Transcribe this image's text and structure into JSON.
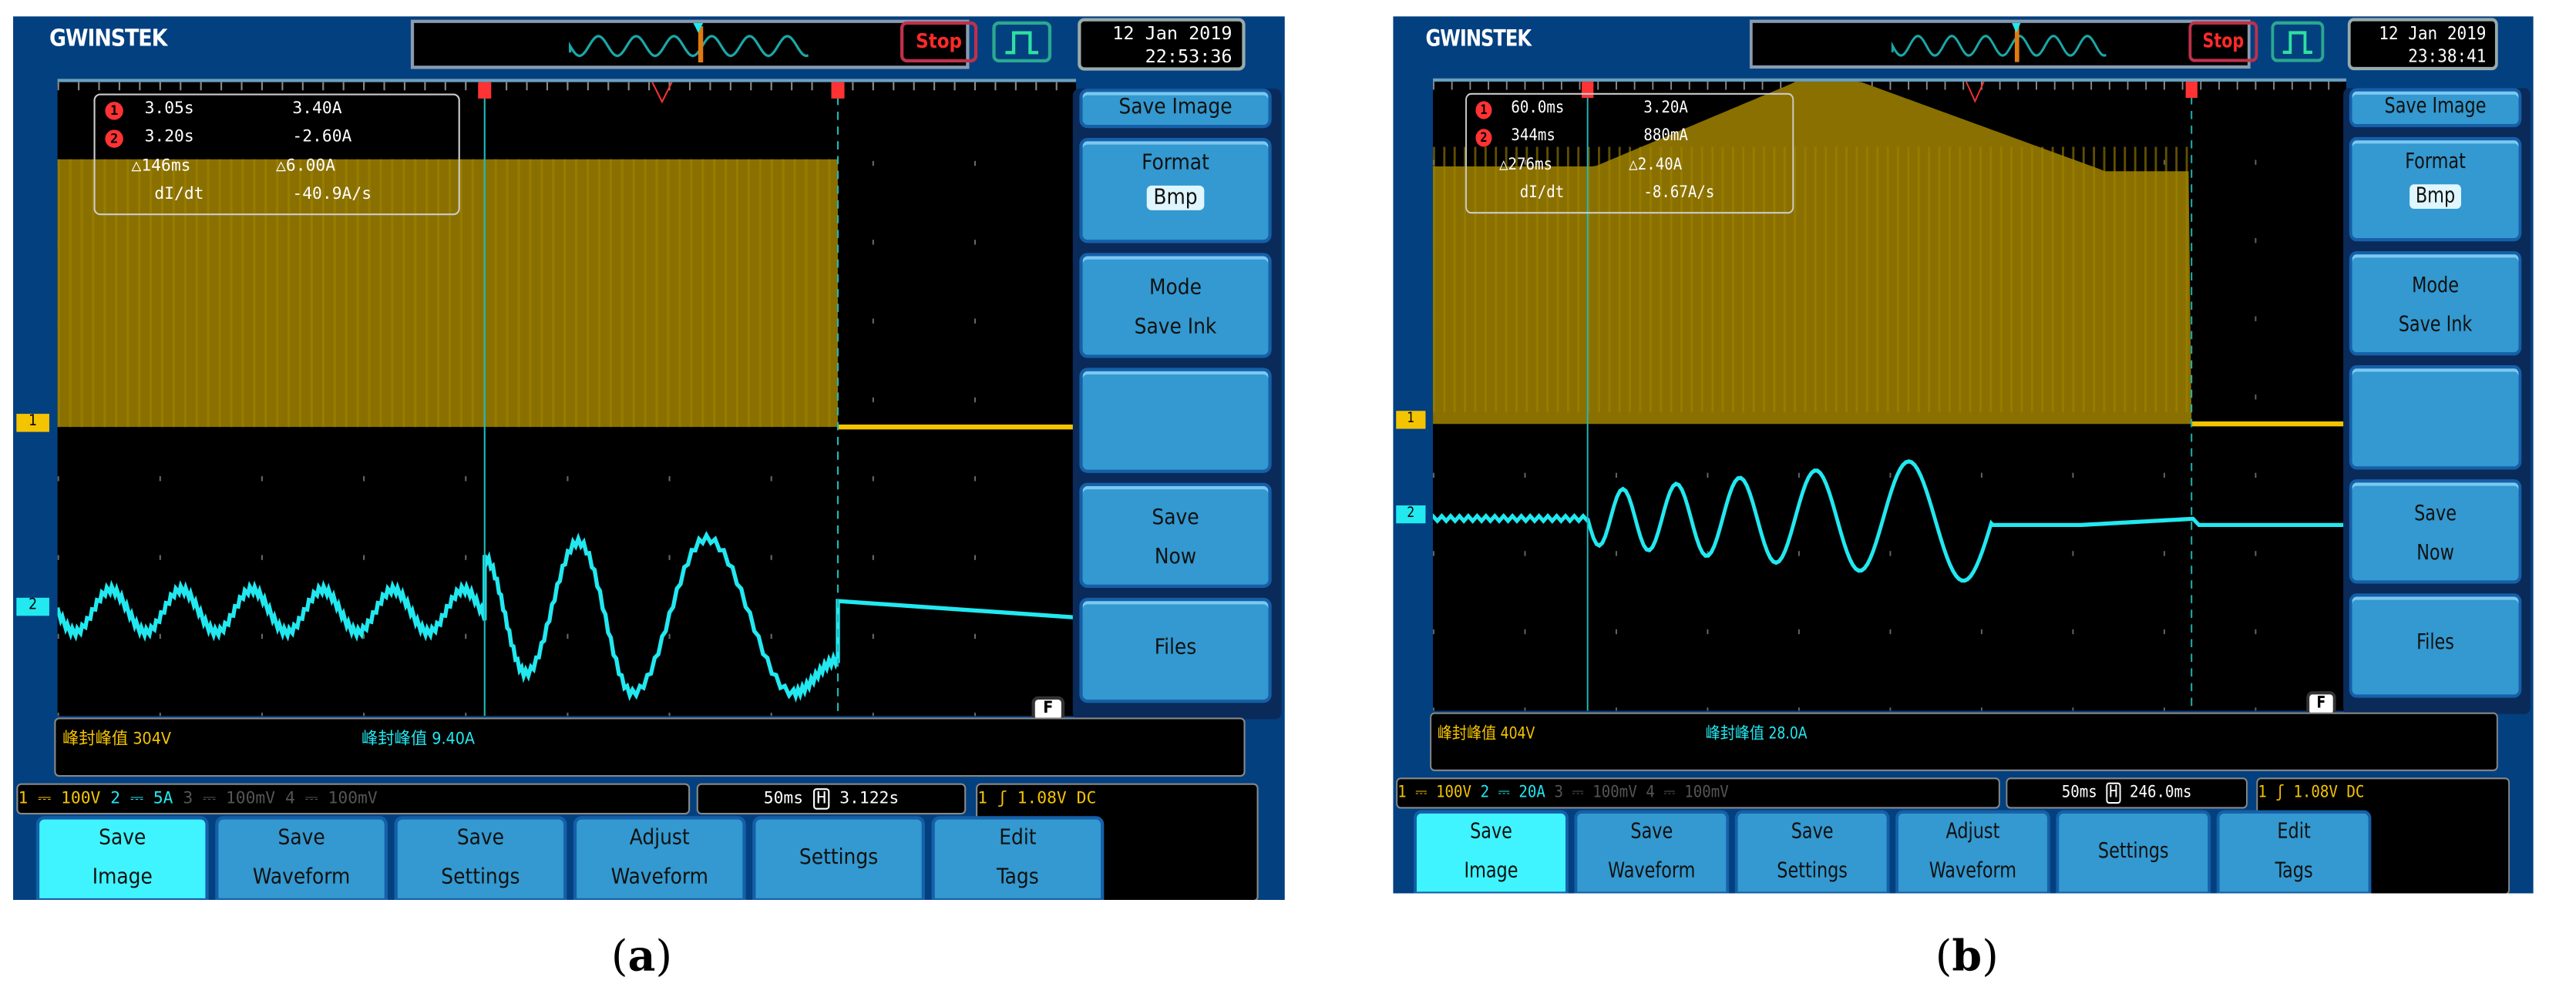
{
  "panels": [
    {
      "id": "a",
      "caption_open": "(",
      "caption_letter": "a",
      "caption_close": ")",
      "brand": "GWINSTEK",
      "run_state": "Stop",
      "date": "12 Jan 2019",
      "time": "22:53:36",
      "cursor1": {
        "time": "3.05s",
        "value": "3.40A"
      },
      "cursor2": {
        "time": "3.20s",
        "value": "-2.60A"
      },
      "delta_time": "△146ms",
      "delta_value": "△6.00A",
      "didt_label": "dI/dt",
      "didt_value": "-40.9A/s",
      "menu": {
        "title": "Save Image",
        "format_label": "Format",
        "format_value": "Bmp",
        "mode_label": "Mode",
        "mode_value": "Save Ink",
        "save_now_1": "Save",
        "save_now_2": "Now",
        "files": "Files",
        "f_key": "F"
      },
      "readout1": "峰封峰值 304V",
      "readout2": "峰封峰值 9.40A",
      "ch1_num": "1",
      "ch2_num": "2",
      "ch3_num": "3",
      "ch4_num": "4",
      "ch1_scale": "100V",
      "ch2_scale": "5A",
      "ch3_scale": "100mV",
      "ch4_scale": "100mV",
      "coupling": "⎓",
      "timebase": "50ms",
      "h_label": "H",
      "h_position": "3.122s",
      "trig_src": "1",
      "trig_slope": "ʃ",
      "trig_level": "1.08V",
      "trig_coupling": "DC",
      "buttons": [
        [
          "Save",
          "Image"
        ],
        [
          "Save",
          "Waveform"
        ],
        [
          "Save",
          "Settings"
        ],
        [
          "Adjust",
          "Waveform"
        ],
        [
          "Settings",
          ""
        ],
        [
          "Edit",
          "Tags"
        ]
      ]
    },
    {
      "id": "b",
      "caption_open": "(",
      "caption_letter": "b",
      "caption_close": ")",
      "brand": "GWINSTEK",
      "run_state": "Stop",
      "date": "12 Jan 2019",
      "time": "23:38:41",
      "cursor1": {
        "time": "60.0ms",
        "value": "3.20A"
      },
      "cursor2": {
        "time": "344ms",
        "value": "880mA"
      },
      "delta_time": "△276ms",
      "delta_value": "△2.40A",
      "didt_label": "dI/dt",
      "didt_value": "-8.67A/s",
      "menu": {
        "title": "Save Image",
        "format_label": "Format",
        "format_value": "Bmp",
        "mode_label": "Mode",
        "mode_value": "Save Ink",
        "save_now_1": "Save",
        "save_now_2": "Now",
        "files": "Files",
        "f_key": "F"
      },
      "readout1": "峰封峰值 404V",
      "readout2": "峰封峰值 28.0A",
      "ch1_num": "1",
      "ch2_num": "2",
      "ch3_num": "3",
      "ch4_num": "4",
      "ch1_scale": "100V",
      "ch2_scale": "20A",
      "ch3_scale": "100mV",
      "ch4_scale": "100mV",
      "coupling": "⎓",
      "timebase": "50ms",
      "h_label": "H",
      "h_position": "246.0ms",
      "trig_src": "1",
      "trig_slope": "ʃ",
      "trig_level": "1.08V",
      "trig_coupling": "DC",
      "buttons": [
        [
          "Save",
          "Image"
        ],
        [
          "Save",
          "Waveform"
        ],
        [
          "Save",
          "Settings"
        ],
        [
          "Adjust",
          "Waveform"
        ],
        [
          "Settings",
          ""
        ],
        [
          "Edit",
          "Tags"
        ]
      ]
    }
  ],
  "colors": {
    "ch1": "#f5c400",
    "ch2": "#22e8f0",
    "frame": "#034080",
    "button": "#3399d0",
    "button_active": "#3ff4ff"
  }
}
